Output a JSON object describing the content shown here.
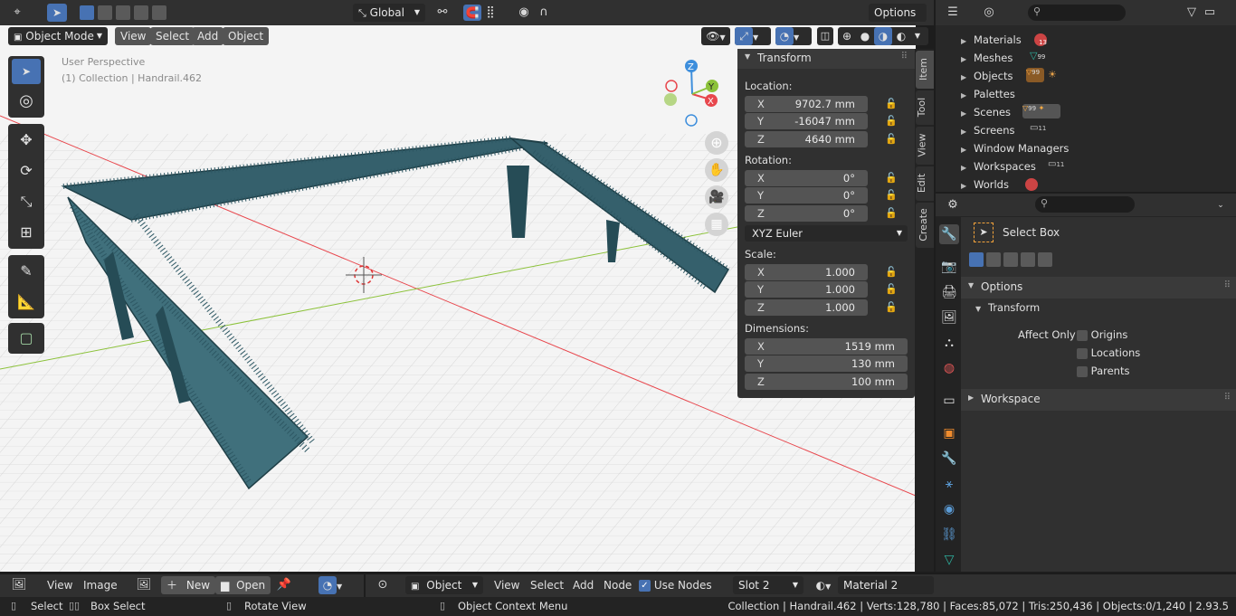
{
  "viewport_header": {
    "mode": "Object Mode",
    "menus": [
      "View",
      "Select",
      "Add",
      "Object"
    ],
    "orientation": "Global",
    "options": "Options"
  },
  "viewport": {
    "perspective": "User Perspective",
    "collection": "(1) Collection | Handrail.462"
  },
  "n_panel": {
    "title": "Transform",
    "location_label": "Location:",
    "location": [
      {
        "axis": "X",
        "value": "9702.7 mm"
      },
      {
        "axis": "Y",
        "value": "-16047 mm"
      },
      {
        "axis": "Z",
        "value": "4640 mm"
      }
    ],
    "rotation_label": "Rotation:",
    "rotation": [
      {
        "axis": "X",
        "value": "0°"
      },
      {
        "axis": "Y",
        "value": "0°"
      },
      {
        "axis": "Z",
        "value": "0°"
      }
    ],
    "rotation_mode": "XYZ Euler",
    "scale_label": "Scale:",
    "scale": [
      {
        "axis": "X",
        "value": "1.000"
      },
      {
        "axis": "Y",
        "value": "1.000"
      },
      {
        "axis": "Z",
        "value": "1.000"
      }
    ],
    "dimensions_label": "Dimensions:",
    "dimensions": [
      {
        "axis": "X",
        "value": "1519 mm"
      },
      {
        "axis": "Y",
        "value": "130 mm"
      },
      {
        "axis": "Z",
        "value": "100 mm"
      }
    ],
    "tabs": [
      "Item",
      "Tool",
      "View",
      "Edit",
      "Create"
    ]
  },
  "outliner": {
    "rows": [
      {
        "label": "Materials",
        "badge": "13"
      },
      {
        "label": "Meshes",
        "badge": "99"
      },
      {
        "label": "Objects",
        "badge": "99"
      },
      {
        "label": "Palettes",
        "badge": ""
      },
      {
        "label": "Scenes",
        "badge": "99"
      },
      {
        "label": "Screens",
        "badge": "11"
      },
      {
        "label": "Window Managers",
        "badge": ""
      },
      {
        "label": "Workspaces",
        "badge": "11"
      },
      {
        "label": "Worlds",
        "badge": ""
      }
    ]
  },
  "properties": {
    "tool_name": "Select Box",
    "options_label": "Options",
    "transform_label": "Transform",
    "affect_only": "Affect Only",
    "checkboxes": [
      "Origins",
      "Locations",
      "Parents"
    ],
    "workspace_label": "Workspace"
  },
  "image_editor_header": {
    "menus": [
      "View",
      "Image"
    ],
    "new_label": "New",
    "open_label": "Open"
  },
  "node_editor_header": {
    "type": "Object",
    "menus": [
      "View",
      "Select",
      "Add",
      "Node"
    ],
    "use_nodes": "Use Nodes",
    "slot": "Slot 2",
    "material": "Material 2"
  },
  "status_bar": {
    "select": "Select",
    "box_select": "Box Select",
    "rotate_view": "Rotate View",
    "context_menu": "Object Context Menu",
    "stats": "Collection | Handrail.462 | Verts:128,780 | Faces:85,072 | Tris:250,436 | Objects:0/1,240 | 2.93.5"
  },
  "colors": {
    "accent": "#4772b3",
    "axis_x": "#e8474d",
    "axis_y": "#8cc23a",
    "axis_z": "#3d8edc",
    "bridge": "#2d5763"
  }
}
